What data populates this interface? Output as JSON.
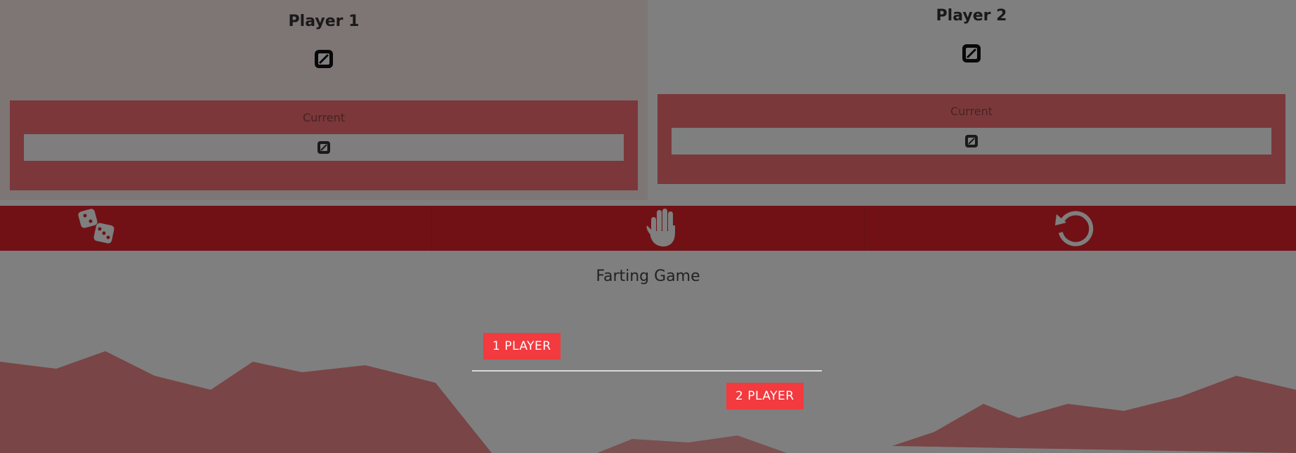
{
  "players": [
    {
      "name": "Player 1",
      "current_label": "Current"
    },
    {
      "name": "Player 2",
      "current_label": "Current"
    }
  ],
  "actions": [
    {
      "icon": "dice-icon"
    },
    {
      "icon": "hand-icon"
    },
    {
      "icon": "reset-icon"
    }
  ],
  "modal": {
    "title": "Farting Game",
    "one_player_label": "1 PLAYER",
    "two_player_label": "2 PLAYER"
  },
  "colors": {
    "accent": "#e2232a",
    "button": "#f23a3f",
    "current_box": "#f5595f"
  }
}
